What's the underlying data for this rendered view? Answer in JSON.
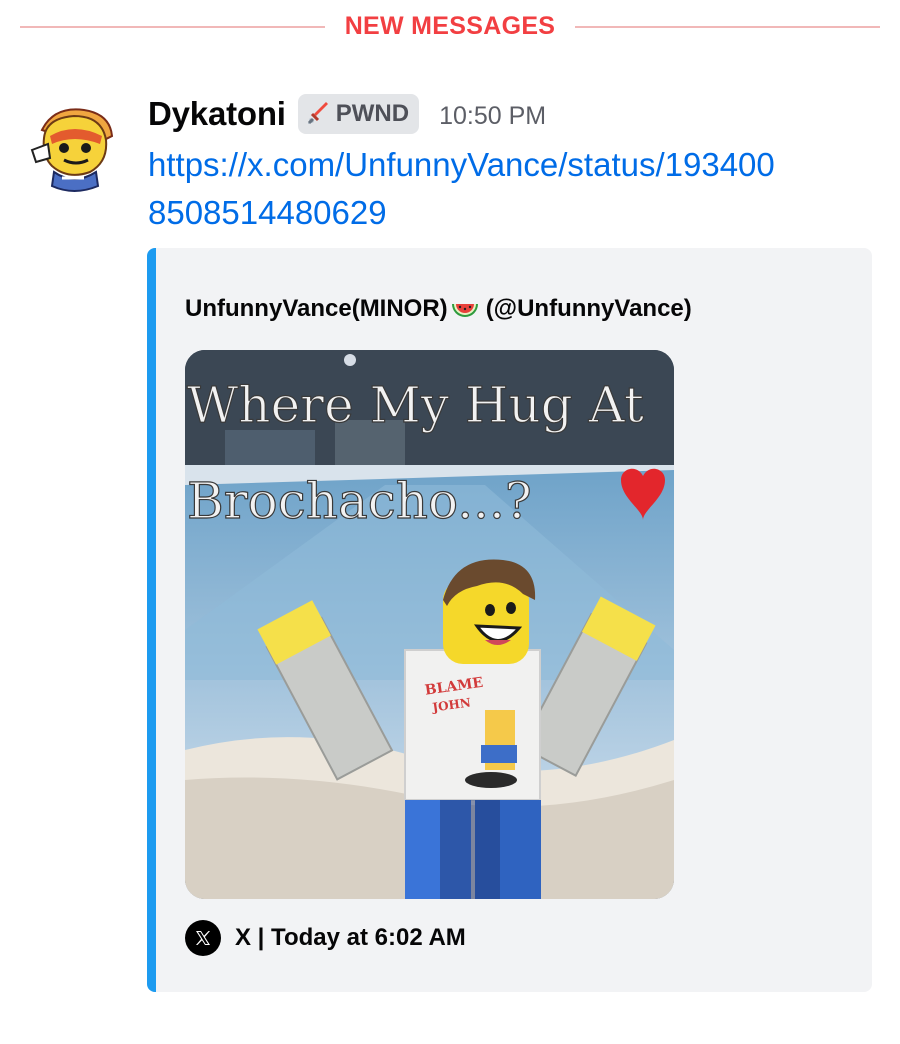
{
  "divider": {
    "label": "NEW MESSAGES",
    "color": "#f23f42"
  },
  "message": {
    "avatar_icon": "avatar-drawing",
    "username": "Dykatoni",
    "tag": {
      "icon": "sword-icon",
      "label": "PWND"
    },
    "timestamp": "10:50 PM",
    "link": "https://x.com/UnfunnyVance/status/1934008508514480629"
  },
  "embed": {
    "accent_color": "#1d9bf0",
    "author": {
      "name": "UnfunnyVance(MINOR)",
      "emoji": "watermelon-icon",
      "handle": "(@UnfunnyVance)"
    },
    "image": {
      "caption_line1": "Where My Hug At",
      "caption_line2": "Brochacho...?",
      "shirt_text_1": "BLAME",
      "shirt_text_2": "JOHN"
    },
    "footer": {
      "provider_icon": "x-logo-icon",
      "text": "X | Today at 6:02 AM"
    }
  }
}
